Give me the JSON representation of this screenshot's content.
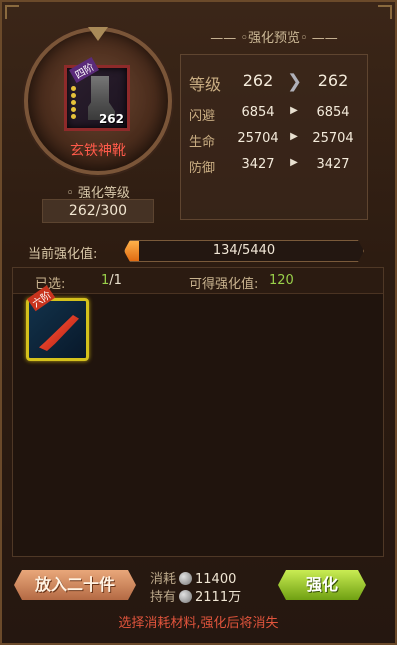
{
  "item": {
    "name": "玄铁神靴",
    "tier_badge": "四阶",
    "level": "262",
    "enhance_level_label": "◦ 强化等级",
    "enhance_level_value": "262/300"
  },
  "preview": {
    "title": "—— ◦强化预览◦ ——",
    "rows": [
      {
        "label": "等级",
        "from": "262",
        "to": "262"
      },
      {
        "label": "闪避",
        "from": "6854",
        "to": "6854"
      },
      {
        "label": "生命",
        "from": "25704",
        "to": "25704"
      },
      {
        "label": "防御",
        "from": "3427",
        "to": "3427"
      }
    ]
  },
  "current": {
    "label": "当前强化值:",
    "value_text": "134/5440",
    "progress": 0.0246
  },
  "materials": {
    "selected_label": "已选:",
    "selected_count": "1",
    "selected_total": "/1",
    "gain_label": "可得强化值:",
    "gain_value": "120",
    "slots": [
      {
        "badge": "六阶",
        "icon": "red-blade-icon"
      }
    ]
  },
  "actions": {
    "put_twenty_label": "放入二十件",
    "enhance_label": "强化",
    "cost_label": "消耗",
    "cost_value": "11400",
    "own_label": "持有",
    "own_value": "2111万"
  },
  "hint": "选择消耗材料,强化后将消失",
  "colors": {
    "item_name": "#ff5a4a",
    "highlight_green": "#9ad04a",
    "hint_red": "#e0543c",
    "bar_fill": "#f08a20"
  }
}
